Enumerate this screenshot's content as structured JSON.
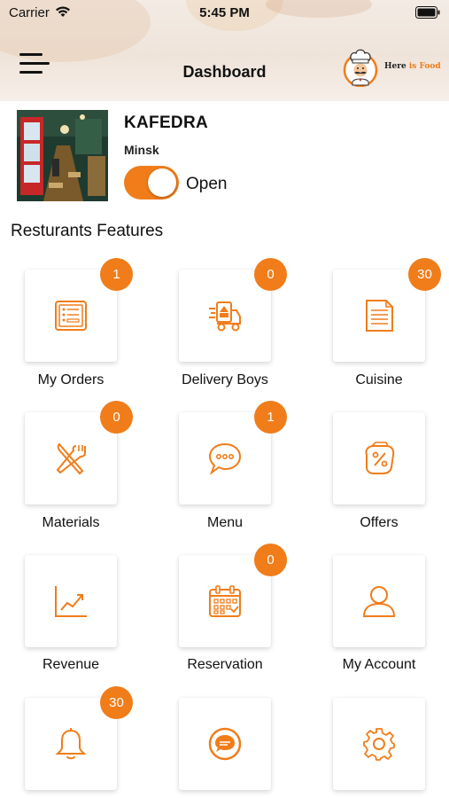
{
  "status_bar": {
    "carrier": "Carrier",
    "time": "5:45 PM"
  },
  "header": {
    "title": "Dashboard",
    "logo": {
      "part1": "Here ",
      "part2": "is",
      "part3": " Food"
    }
  },
  "restaurant": {
    "name": "KAFEDRA",
    "city": "Minsk",
    "status_label": "Open",
    "is_open": true
  },
  "features": {
    "title": "Resturants Features",
    "items": [
      {
        "label": "My Orders",
        "badge": "1",
        "icon": "orders-list-icon"
      },
      {
        "label": "Delivery Boys",
        "badge": "0",
        "icon": "delivery-truck-icon"
      },
      {
        "label": "Cuisine",
        "badge": "30",
        "icon": "document-icon"
      },
      {
        "label": "Materials",
        "badge": "0",
        "icon": "knife-fork-icon"
      },
      {
        "label": "Menu",
        "badge": "1",
        "icon": "chat-bubble-icon"
      },
      {
        "label": "Offers",
        "badge": null,
        "icon": "discount-tag-icon"
      },
      {
        "label": "Revenue",
        "badge": null,
        "icon": "chart-trend-icon"
      },
      {
        "label": "Reservation",
        "badge": "0",
        "icon": "calendar-icon"
      },
      {
        "label": "My Account",
        "badge": null,
        "icon": "user-icon"
      },
      {
        "label": "",
        "badge": "30",
        "icon": "bell-icon"
      },
      {
        "label": "",
        "badge": null,
        "icon": "message-icon"
      },
      {
        "label": "",
        "badge": null,
        "icon": "gear-icon"
      }
    ]
  },
  "colors": {
    "accent": "#f07d1a",
    "text": "#111111"
  }
}
